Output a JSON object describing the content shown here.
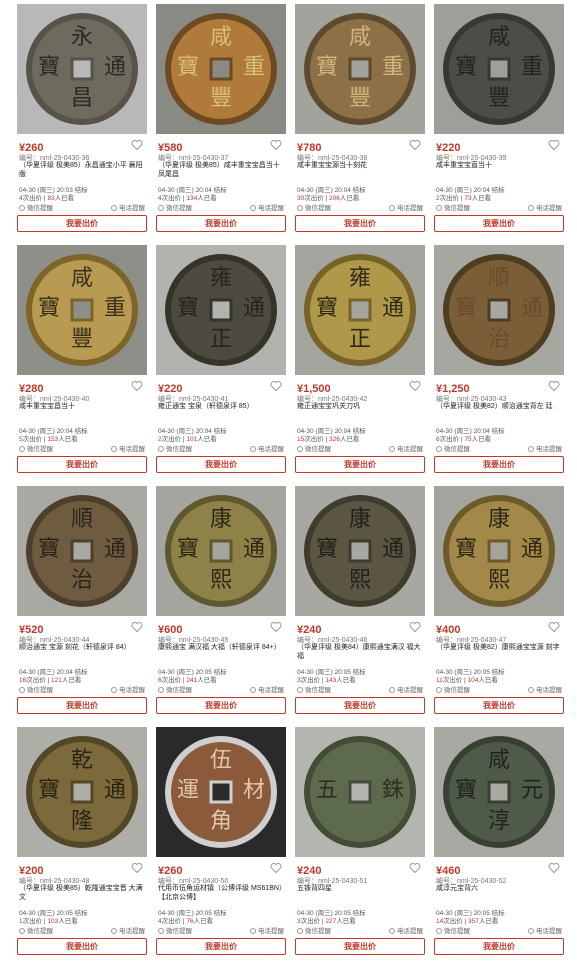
{
  "bid_label": "我要出价",
  "wechat_label": "微信提醒",
  "phone_label": "电话提醒",
  "watch_suffix": "人已看",
  "bid_suffix": "次出价",
  "items": [
    {
      "price": "¥260",
      "code": "编号：nml-25-0430-36",
      "title": "（华夏评级 极美85）永昌通宝小平 襄阳版",
      "time": "04-30 (周三) 20:03 结标",
      "bids": "4",
      "views": "83",
      "coin": {
        "bg": "#b8b8b8",
        "face": "#6e6a5e",
        "rim": "#575348",
        "text": "#2b2a26",
        "chars": [
          "永",
          "昌",
          "寶",
          "通"
        ]
      }
    },
    {
      "price": "¥580",
      "code": "编号：nml-25-0430-37",
      "title": "（华夏评级 极美85）咸丰重宝宝昌当十凤尾昌",
      "time": "04-30 (周三) 20:04 结标",
      "bids": "4",
      "views": "134",
      "coin": {
        "bg": "#8a8a84",
        "face": "#b07a3a",
        "rim": "#6e4a22",
        "text": "#d9bf78",
        "chars": [
          "咸",
          "豐",
          "寶",
          "重"
        ]
      }
    },
    {
      "price": "¥780",
      "code": "编号：nml-25-0430-38",
      "title": "咸丰重宝宝源当十刻花",
      "time": "04-30 (周三) 20:04 结标",
      "bids": "30",
      "views": "206",
      "coin": {
        "bg": "#a3a39e",
        "face": "#8b7048",
        "rim": "#5e4a2e",
        "text": "#d2b57e",
        "chars": [
          "咸",
          "豐",
          "寶",
          "重"
        ]
      }
    },
    {
      "price": "¥220",
      "code": "编号：nml-25-0430-39",
      "title": "咸丰重宝宝直当十",
      "time": "04-30 (周三) 20:04 结标",
      "bids": "2",
      "views": "73",
      "coin": {
        "bg": "#9e9e9a",
        "face": "#4e4c46",
        "rim": "#393731",
        "text": "#23221f",
        "chars": [
          "咸",
          "豐",
          "寶",
          "重"
        ]
      }
    },
    {
      "price": "¥280",
      "code": "编号：nml-25-0430-40",
      "title": "咸丰重宝宝昌当十",
      "time": "04-30 (周三) 20:04 结标",
      "bids": "5",
      "views": "153",
      "coin": {
        "bg": "#8f8f8a",
        "face": "#b89a52",
        "rim": "#7d6428",
        "text": "#3a2f18",
        "chars": [
          "咸",
          "豐",
          "寶",
          "重"
        ]
      }
    },
    {
      "price": "¥220",
      "code": "编号：nml-25-0430-41",
      "title": "雍正通宝 宝泉（轩德泉评 85）",
      "time": "04-30 (周三) 20:04 结标",
      "bids": "2",
      "views": "101",
      "coin": {
        "bg": "#b2b2ae",
        "face": "#4d4a40",
        "rim": "#363429",
        "text": "#26241d",
        "chars": [
          "雍",
          "正",
          "寶",
          "通"
        ]
      }
    },
    {
      "price": "¥1,500",
      "code": "编号：nml-25-0430-42",
      "title": "雍正通宝宝巩关刀巩",
      "time": "04-30 (周三) 20:04 结标",
      "bids": "15",
      "views": "326",
      "coin": {
        "bg": "#a4a49f",
        "face": "#b0984a",
        "rim": "#776228",
        "text": "#2f2814",
        "chars": [
          "雍",
          "正",
          "寶",
          "通"
        ]
      }
    },
    {
      "price": "¥1,250",
      "code": "编号：nml-25-0430-43",
      "title": "（华夏评级 极美82）顺治通宝背左 廷",
      "time": "04-30 (周三) 20:04 结标",
      "bids": "6",
      "views": "75",
      "coin": {
        "bg": "#a7a7a2",
        "face": "#7a5e38",
        "rim": "#4f3d22",
        "text": "#6b4a2a",
        "chars": [
          "順",
          "治",
          "寶",
          "通"
        ]
      }
    },
    {
      "price": "¥520",
      "code": "编号：nml-25-0430-44",
      "title": "顺治通宝 宝源 刻花（轩德泉评 84）",
      "time": "04-30 (周三) 20:04 结标",
      "bids": "16",
      "views": "121",
      "coin": {
        "bg": "#a9a9a4",
        "face": "#6f5b40",
        "rim": "#4d3f2c",
        "text": "#2c241a",
        "chars": [
          "順",
          "治",
          "寶",
          "通"
        ]
      }
    },
    {
      "price": "¥600",
      "code": "编号：nml-25-0430-45",
      "title": "康熙通宝 满汉福 大福（轩德泉评 84+）",
      "time": "04-30 (周三) 20:05 结标",
      "bids": "6",
      "views": "241",
      "coin": {
        "bg": "#a5a5a0",
        "face": "#8e8249",
        "rim": "#5f572e",
        "text": "#2b2713",
        "chars": [
          "康",
          "熙",
          "寶",
          "通"
        ]
      }
    },
    {
      "price": "¥240",
      "code": "编号：nml-25-0430-46",
      "title": "（华夏评级 极美84）康熙通宝满汉 福大福",
      "time": "04-30 (周三) 20:05 结标",
      "bids": "3",
      "views": "143",
      "coin": {
        "bg": "#a8a8a3",
        "face": "#5a5643",
        "rim": "#3f3c2d",
        "text": "#222019",
        "chars": [
          "康",
          "熙",
          "寶",
          "通"
        ]
      }
    },
    {
      "price": "¥400",
      "code": "编号：nml-25-0430-47",
      "title": "（华夏评级 极美82）康熙通宝宝源 刻字",
      "time": "04-30 (周三) 20:05 结标",
      "bids": "11",
      "views": "104",
      "coin": {
        "bg": "#a4a49f",
        "face": "#a2894a",
        "rim": "#6d5a2a",
        "text": "#2f2612",
        "chars": [
          "康",
          "熙",
          "寶",
          "通"
        ]
      }
    },
    {
      "price": "¥200",
      "code": "编号：nml-25-0430-48",
      "title": "（华夏评级 极美85）乾隆通宝宝晋 大满文",
      "time": "04-30 (周三) 20:05 结标",
      "bids": "1",
      "views": "103",
      "coin": {
        "bg": "#aeaea9",
        "face": "#7c6a3c",
        "rim": "#544726",
        "text": "#2b2414",
        "chars": [
          "乾",
          "隆",
          "寶",
          "通"
        ]
      }
    },
    {
      "price": "¥260",
      "code": "编号：nml-25-0430-50",
      "title": "代用币伍角运材镇（公博评级 MS61BN）【北京公博】",
      "time": "04-30 (周三) 20:05 结标",
      "bids": "4",
      "views": "76",
      "coin": {
        "bg": "#2a2a2a",
        "face": "#8a5a3a",
        "rim": "#cfcfcf",
        "text": "#e2c6a8",
        "chars": [
          "伍",
          "角",
          "運",
          "材"
        ]
      }
    },
    {
      "price": "¥240",
      "code": "编号：nml-25-0430-51",
      "title": "五铢背四星",
      "time": "04-30 (周三) 20:05 结标",
      "bids": "3",
      "views": "227",
      "coin": {
        "bg": "#b6b6b1",
        "face": "#5e6a4e",
        "rim": "#434c37",
        "text": "#2a2f22",
        "chars": [
          "",
          "",
          "五",
          "銖"
        ]
      }
    },
    {
      "price": "¥460",
      "code": "编号：nml-25-0430-52",
      "title": "咸淳元宝背六",
      "time": "04-30 (周三) 20:05 结标",
      "bids": "14",
      "views": "357",
      "coin": {
        "bg": "#a9a9a4",
        "face": "#4f5a48",
        "rim": "#384033",
        "text": "#1e231b",
        "chars": [
          "咸",
          "淳",
          "寶",
          "元"
        ]
      }
    }
  ]
}
